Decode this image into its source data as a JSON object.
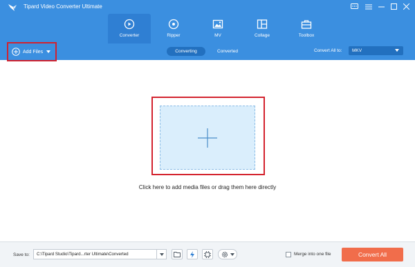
{
  "app": {
    "title": "Tipard Video Converter Ultimate"
  },
  "nav": {
    "tabs": [
      {
        "label": "Converter",
        "icon": "converter-icon",
        "active": true
      },
      {
        "label": "Ripper",
        "icon": "ripper-disc-icon",
        "active": false
      },
      {
        "label": "MV",
        "icon": "mv-image-icon",
        "active": false
      },
      {
        "label": "Collage",
        "icon": "collage-icon",
        "active": false
      },
      {
        "label": "Toolbox",
        "icon": "toolbox-icon",
        "active": false
      }
    ]
  },
  "toolbar": {
    "add_files_label": "Add Files",
    "segments": [
      {
        "label": "Converting",
        "active": true
      },
      {
        "label": "Converted",
        "active": false
      }
    ],
    "convert_all_label": "Convert All to:",
    "format_value": "MKV"
  },
  "main": {
    "drop_hint": "Click here to add media files or drag them here directly"
  },
  "bottom": {
    "save_to_label": "Save to:",
    "save_path": "C:\\Tipard Studio\\Tipard...rter Ultimate\\Converted",
    "merge_label": "Merge into one file",
    "merge_checked": false,
    "convert_all_button": "Convert All"
  },
  "colors": {
    "header_blue": "#3b8fe0",
    "active_tab": "#2f7fd3",
    "highlight_red": "#d3212d",
    "drop_zone_fill": "#daeefc",
    "convert_orange": "#f16d4b"
  }
}
